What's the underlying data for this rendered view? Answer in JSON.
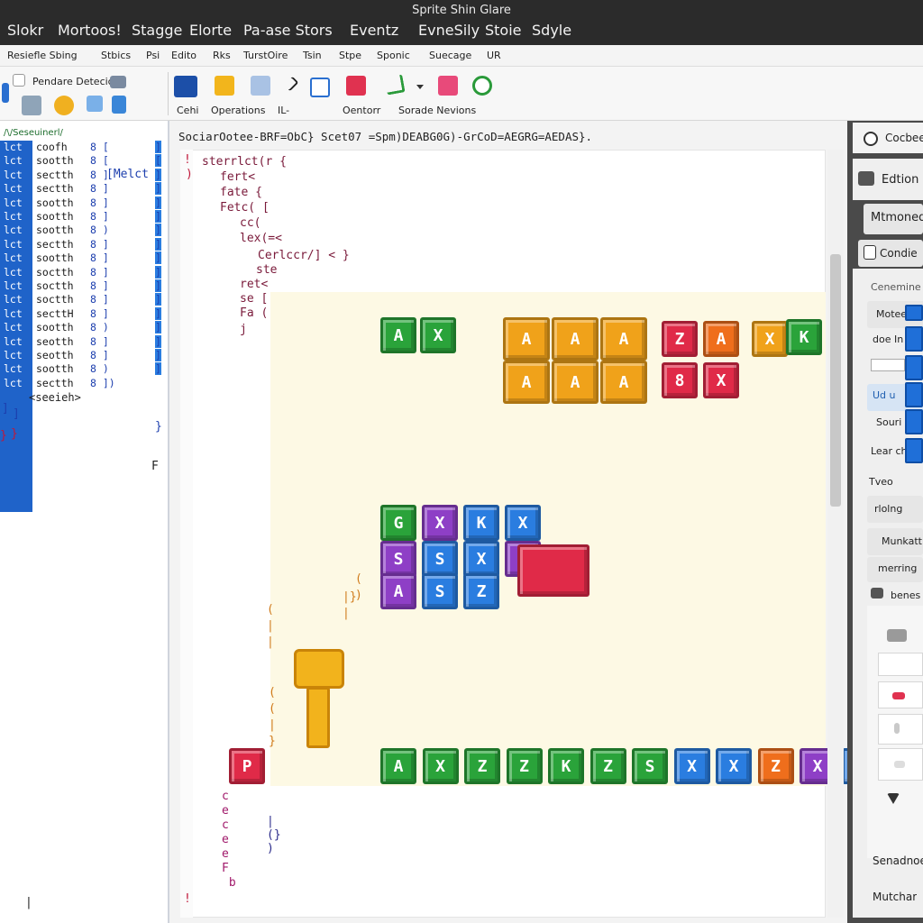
{
  "window": {
    "title": "Sprite Shin Glare"
  },
  "menu": [
    "Slokr",
    "Mortoos!",
    "Stagge",
    "Elorte",
    "Pa-ase Stors",
    "Eventz",
    "EvneSily",
    "Stoie",
    "Sdyle"
  ],
  "ribbon_tabs": [
    "Resiefle Sbing",
    "Stbics",
    "Psi",
    "Edito",
    "Rks",
    "TurstOire",
    "Tsin",
    "Stpe",
    "Sponic",
    "Suecage",
    "UR"
  ],
  "toolbar": {
    "left_label": "Pendare Detecic",
    "groups": [
      {
        "label": "Cehi"
      },
      {
        "label": "Operations"
      },
      {
        "label": "IL-"
      },
      {
        "label": "Oentorr"
      },
      {
        "label": "Sorade Nevions"
      }
    ]
  },
  "sprite_list": {
    "header": "/\\/Seseuinerl/",
    "rows": [
      {
        "key": "lct",
        "name": "coofh",
        "note": "8 [",
        "end": "]"
      },
      {
        "key": "lct",
        "name": "sootth",
        "note": "8 [",
        "end": "["
      },
      {
        "key": "lct",
        "name": "sectth",
        "note": "8 ]",
        "end": "]"
      },
      {
        "key": "lct",
        "name": "sectth",
        "note": "8 ]",
        "end": "]"
      },
      {
        "key": "lct",
        "name": "sootth",
        "note": "8 ]",
        "end": "]"
      },
      {
        "key": "lct",
        "name": "sootth",
        "note": "8 ]",
        "end": "]"
      },
      {
        "key": "lct",
        "name": "sootth",
        "note": "8 )",
        "end": "]"
      },
      {
        "key": "lct",
        "name": "sectth",
        "note": "8 ]",
        "end": "]"
      },
      {
        "key": "lct",
        "name": "sootth",
        "note": "8 ]",
        "end": "]"
      },
      {
        "key": "lct",
        "name": "soctth",
        "note": "8 ]",
        "end": "]"
      },
      {
        "key": "lct",
        "name": "soctth",
        "note": "8 ]",
        "end": "]"
      },
      {
        "key": "lct",
        "name": "soctth",
        "note": "8 ]",
        "end": "]"
      },
      {
        "key": "lct",
        "name": "secttH",
        "note": "8 ]",
        "end": "]"
      },
      {
        "key": "lct",
        "name": "sootth",
        "note": "8 )",
        "end": "]"
      },
      {
        "key": "lct",
        "name": "seotth",
        "note": "8 ]",
        "end": "]"
      },
      {
        "key": "lct",
        "name": "seotth",
        "note": "8 ]",
        "end": "]"
      },
      {
        "key": "lct",
        "name": "sootth",
        "note": "8 )",
        "end": "]"
      },
      {
        "key": "lct",
        "name": "sectth",
        "note": "8 ])",
        "end": ""
      }
    ],
    "tag": "[Melct",
    "footer": "<seeieh>"
  },
  "code": {
    "header": "SociarOotee-BRF=ObC} Scet07 =Spm)DEABG0G)-GrCoD=AEGRG=AEDAS}.",
    "lines": [
      "sterrlct(r {",
      "fert<",
      "fate {",
      "Fetc( [",
      "cc(",
      "lex(=<",
      "Cerlccr/] <   }",
      "ste",
      "ret<",
      "se [",
      "Fa (",
      "j"
    ]
  },
  "stage_blocks": {
    "row1": [
      "A",
      "X"
    ],
    "row1_gold": [
      "A",
      "A",
      "A",
      "A",
      "A",
      "A"
    ],
    "row1_red": [
      "Z",
      "8"
    ],
    "row1_orange": [
      "A",
      "X"
    ],
    "row1_end": [
      "X",
      "K"
    ],
    "grid": [
      "G",
      "X",
      "K",
      "X",
      "S",
      "S",
      "X",
      "A",
      "S",
      "Z",
      "X"
    ],
    "bottom": [
      "A",
      "X",
      "Z",
      "Z",
      "K",
      "Z",
      "S",
      "X",
      "X",
      "Z",
      "X",
      "X"
    ],
    "red_single": "P"
  },
  "right_panel": {
    "items": [
      "Cocbee",
      "Edtion",
      "Mtmoned",
      "Condie",
      "Cenemine",
      "Motee",
      "doe In",
      "Ud u",
      "Souri",
      "Lear ch",
      "Tveo",
      "rlolng",
      "Munkatt",
      "merring",
      "benes",
      "Senadnoe",
      "Mutchar"
    ]
  }
}
